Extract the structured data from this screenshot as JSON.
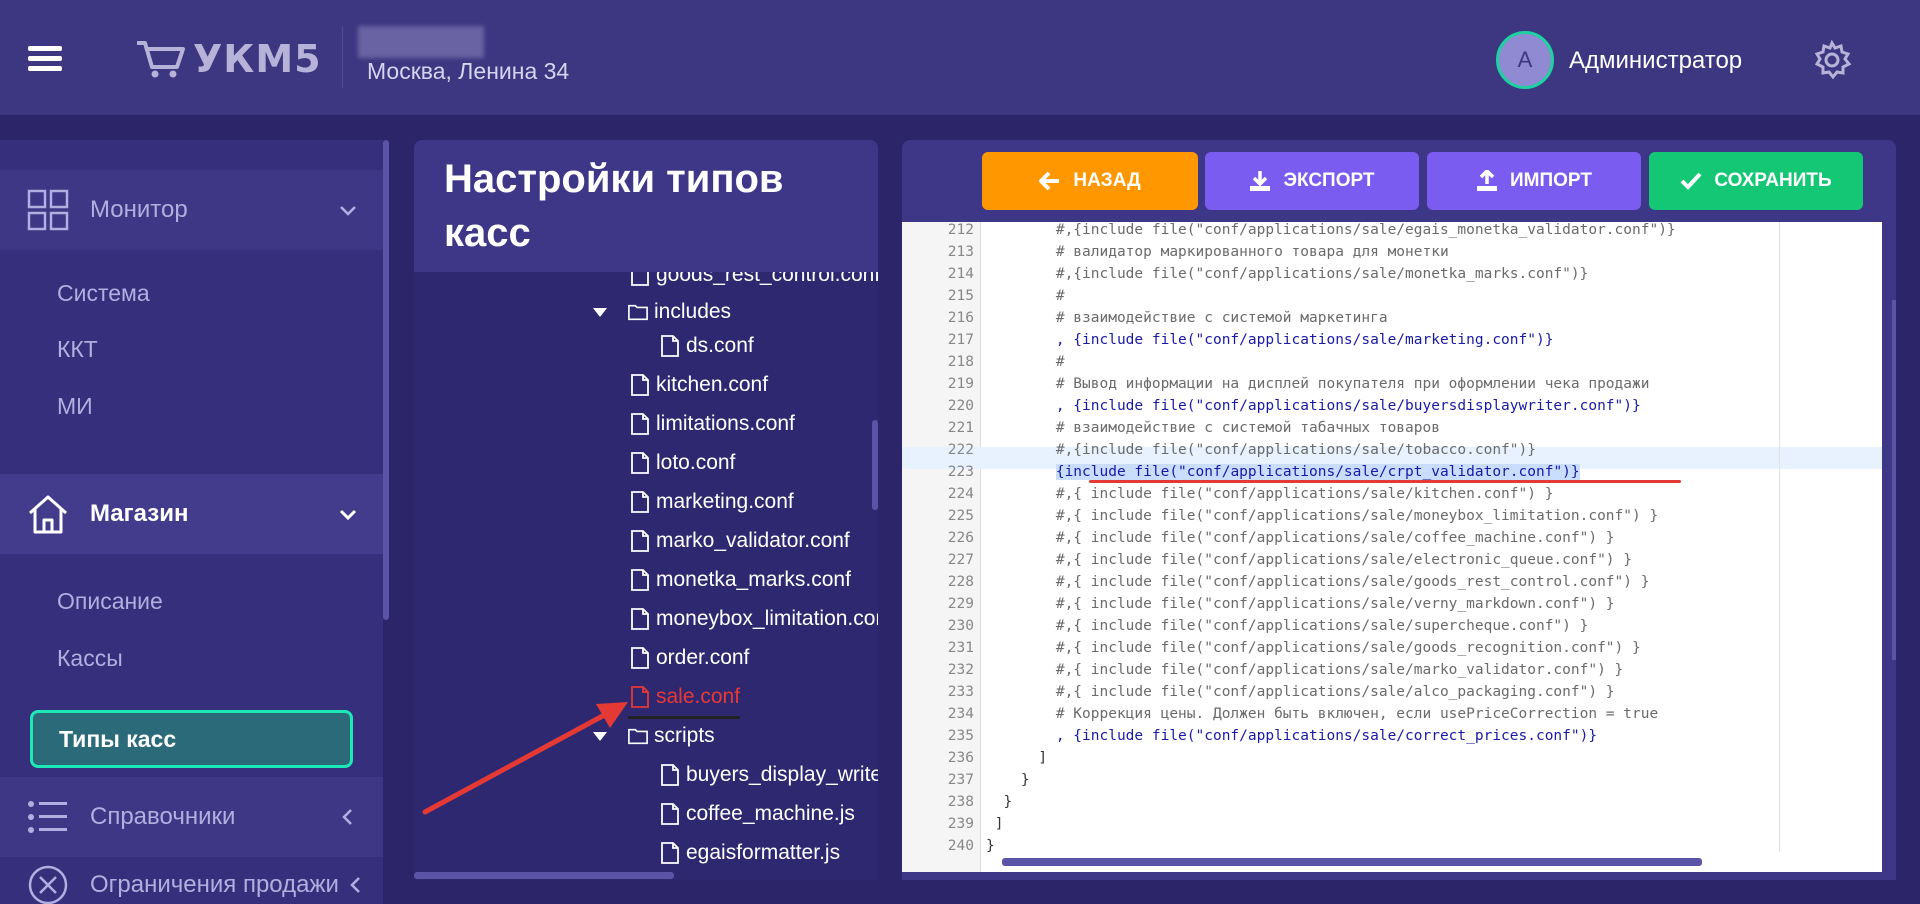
{
  "header": {
    "logo_text": "УКМ5",
    "store_address": "Москва, Ленина 34",
    "user_initial": "A",
    "user_name": "Администратор"
  },
  "sidebar": {
    "monitor_label": "Монитор",
    "monitor_items": [
      "Система",
      "ККТ",
      "МИ"
    ],
    "shop_label": "Магазин",
    "shop_items": [
      "Описание",
      "Кассы"
    ],
    "active_item": "Типы касс",
    "refs_label": "Справочники",
    "limits_label": "Ограничения продажи"
  },
  "panel": {
    "title": "Настройки типов касс"
  },
  "tree": {
    "items": [
      "goods_rest_control.conf",
      "includes",
      "ds.conf",
      "kitchen.conf",
      "limitations.conf",
      "loto.conf",
      "marketing.conf",
      "marko_validator.conf",
      "monetka_marks.conf",
      "moneybox_limitation.conf",
      "order.conf",
      "sale.conf",
      "scripts",
      "buyers_display_writer.js",
      "coffee_machine.js",
      "egaisformatter.js"
    ]
  },
  "toolbar": {
    "back": "НАЗАД",
    "export": "ЭКСПОРТ",
    "import": "ИМПОРТ",
    "save": "СОХРАНИТЬ"
  },
  "editor": {
    "line_numbers": [
      "212",
      "213",
      "214",
      "215",
      "216",
      "217",
      "218",
      "219",
      "220",
      "221",
      "222",
      "223",
      "224",
      "225",
      "226",
      "227",
      "228",
      "229",
      "230",
      "231",
      "232",
      "233",
      "234",
      "235",
      "236",
      "237",
      "238",
      "239",
      "240"
    ],
    "lines": [
      "        #,{include file(\"conf/applications/sale/egais_monetka_validator.conf\")}",
      "        # валидатор маркированного товара для монетки",
      "        #,{include file(\"conf/applications/sale/monetka_marks.conf\")}",
      "        #",
      "        # взаимодействие с системой маркетинга",
      "        , {include file(\"conf/applications/sale/marketing.conf\")}",
      "        #",
      "        # Вывод информации на дисплей покупателя при оформлении чека продажи",
      "        , {include file(\"conf/applications/sale/buyersdisplaywriter.conf\")}",
      "        # взаимодействие с системой табачных товаров",
      "        #,{include file(\"conf/applications/sale/tobacco.conf\")}",
      "        {include file(\"conf/applications/sale/crpt_validator.conf\")}",
      "        #,{ include file(\"conf/applications/sale/kitchen.conf\") }",
      "        #,{ include file(\"conf/applications/sale/moneybox_limitation.conf\") }",
      "        #,{ include file(\"conf/applications/sale/coffee_machine.conf\") }",
      "        #,{ include file(\"conf/applications/sale/electronic_queue.conf\") }",
      "        #,{ include file(\"conf/applications/sale/goods_rest_control.conf\") }",
      "        #,{ include file(\"conf/applications/sale/verny_markdown.conf\") }",
      "        #,{ include file(\"conf/applications/sale/supercheque.conf\") }",
      "        #,{ include file(\"conf/applications/sale/goods_recognition.conf\") }",
      "        #,{ include file(\"conf/applications/sale/marko_validator.conf\") }",
      "        #,{ include file(\"conf/applications/sale/alco_packaging.conf\") }",
      "        # Коррекция цены. Должен быть включен, если usePriceCorrection = true",
      "        , {include file(\"conf/applications/sale/correct_prices.conf\")}",
      "      ]",
      "    }",
      "  }",
      " ]",
      "}"
    ]
  },
  "colors": {
    "accent_orange": "#ff9800",
    "accent_purple": "#7b5cf0",
    "accent_green": "#14c774",
    "active_border": "#1de9b6",
    "header_bg": "#3d3680"
  }
}
